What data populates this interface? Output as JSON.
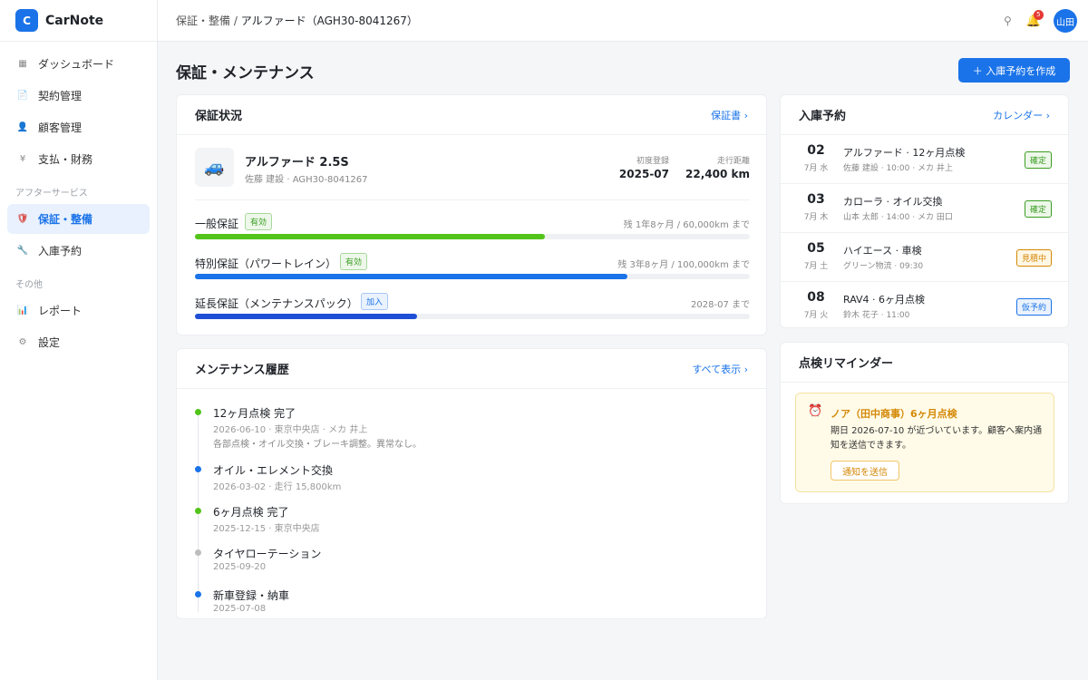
{
  "app": {
    "logo_letter": "C",
    "name": "CarNote"
  },
  "sidebar": {
    "items": [
      {
        "icon": "dashboard-icon",
        "glyph": "▦",
        "label": "ダッシュボード"
      },
      {
        "icon": "contract-icon",
        "glyph": "📄",
        "label": "契約管理"
      },
      {
        "icon": "customer-icon",
        "glyph": "👤",
        "label": "顧客管理"
      },
      {
        "icon": "yen-icon",
        "glyph": "¥",
        "label": "支払・財務"
      }
    ],
    "section_after": "アフターサービス",
    "after_items": [
      {
        "icon": "shield-icon",
        "glyph": "🛡",
        "label": "保証・整備",
        "active": true
      },
      {
        "icon": "wrench-icon",
        "glyph": "🔧",
        "label": "入庫予約"
      }
    ],
    "section_other": "その他",
    "other_items": [
      {
        "icon": "chart-icon",
        "glyph": "📊",
        "label": "レポート"
      },
      {
        "icon": "gear-icon",
        "glyph": "⚙",
        "label": "設定"
      }
    ]
  },
  "topbar": {
    "breadcrumb_parent": "保証・整備",
    "breadcrumb_sep": " / ",
    "breadcrumb_current": "アルファード（AGH30-8041267）",
    "notification_count": "5",
    "user": "山田"
  },
  "page": {
    "title": "保証・メンテナンス",
    "create_button": "＋ 入庫予約を作成"
  },
  "warranty": {
    "title": "保証状況",
    "link": "保証書 ›",
    "vehicle": {
      "name": "アルファード 2.5S",
      "sub": "佐藤 建設 · AGH30-8041267"
    },
    "first_reg_label": "初度登録",
    "first_reg": "2025-07",
    "mileage_label": "走行距離",
    "mileage": "22,400 km",
    "rows": [
      {
        "name": "一般保証",
        "status": "有効",
        "remaining": "残 1年8ヶ月 / 60,000km まで",
        "progress": 0.63,
        "color": "#52c41a"
      },
      {
        "name": "特別保証（パワートレイン）",
        "status": "有効",
        "remaining": "残 3年8ヶ月 / 100,000km まで",
        "progress": 0.78,
        "color": "#1a73e8"
      },
      {
        "name": "延長保証（メンテナンスパック）",
        "status": "加入",
        "remaining": "2028-07 まで",
        "progress": 0.4,
        "color": "#1f4fd6"
      }
    ]
  },
  "history": {
    "title": "メンテナンス履歴",
    "link": "すべて表示 ›",
    "items": [
      {
        "title": "12ヶ月点検 完了",
        "sub": "2026-06-10 · 東京中央店 · メカ 井上",
        "desc": "各部点検・オイル交換・ブレーキ調整。異常なし。",
        "color": "#52c41a"
      },
      {
        "title": "オイル・エレメント交換",
        "sub": "2026-03-02 · 走行 15,800km",
        "desc": "",
        "color": "#1a73e8"
      },
      {
        "title": "6ヶ月点検 完了",
        "sub": "2025-12-15 · 東京中央店",
        "desc": "",
        "color": "#52c41a"
      },
      {
        "title": "タイヤローテーション",
        "sub": "2025-09-20",
        "desc": "",
        "color": "#bdbdbd"
      },
      {
        "title": "新車登録・納車",
        "sub": "2025-07-08",
        "desc": "",
        "color": "#1a73e8"
      }
    ]
  },
  "appointments": {
    "title": "入庫予約",
    "link": "カレンダー ›",
    "items": [
      {
        "day": "02",
        "md": "7月 水",
        "title": "アルファード · 12ヶ月点検",
        "sub": "佐藤 建設 · 10:00 · メカ 井上",
        "status": "確定",
        "tone": "green"
      },
      {
        "day": "03",
        "md": "7月 木",
        "title": "カローラ · オイル交換",
        "sub": "山本 太郎 · 14:00 · メカ 田口",
        "status": "確定",
        "tone": "green"
      },
      {
        "day": "05",
        "md": "7月 土",
        "title": "ハイエース · 車検",
        "sub": "グリーン物流 · 09:30",
        "status": "見積中",
        "tone": "orange"
      },
      {
        "day": "08",
        "md": "7月 火",
        "title": "RAV4 · 6ヶ月点検",
        "sub": "鈴木 花子 · 11:00",
        "status": "仮予約",
        "tone": "blue"
      }
    ]
  },
  "reminder": {
    "title": "点検リマインダー",
    "item_title": "ノア（田中商事）6ヶ月点検",
    "item_desc": "期日 2026-07-10 が近づいています。顧客へ案内通知を送信できます。",
    "button": "通知を送信"
  }
}
